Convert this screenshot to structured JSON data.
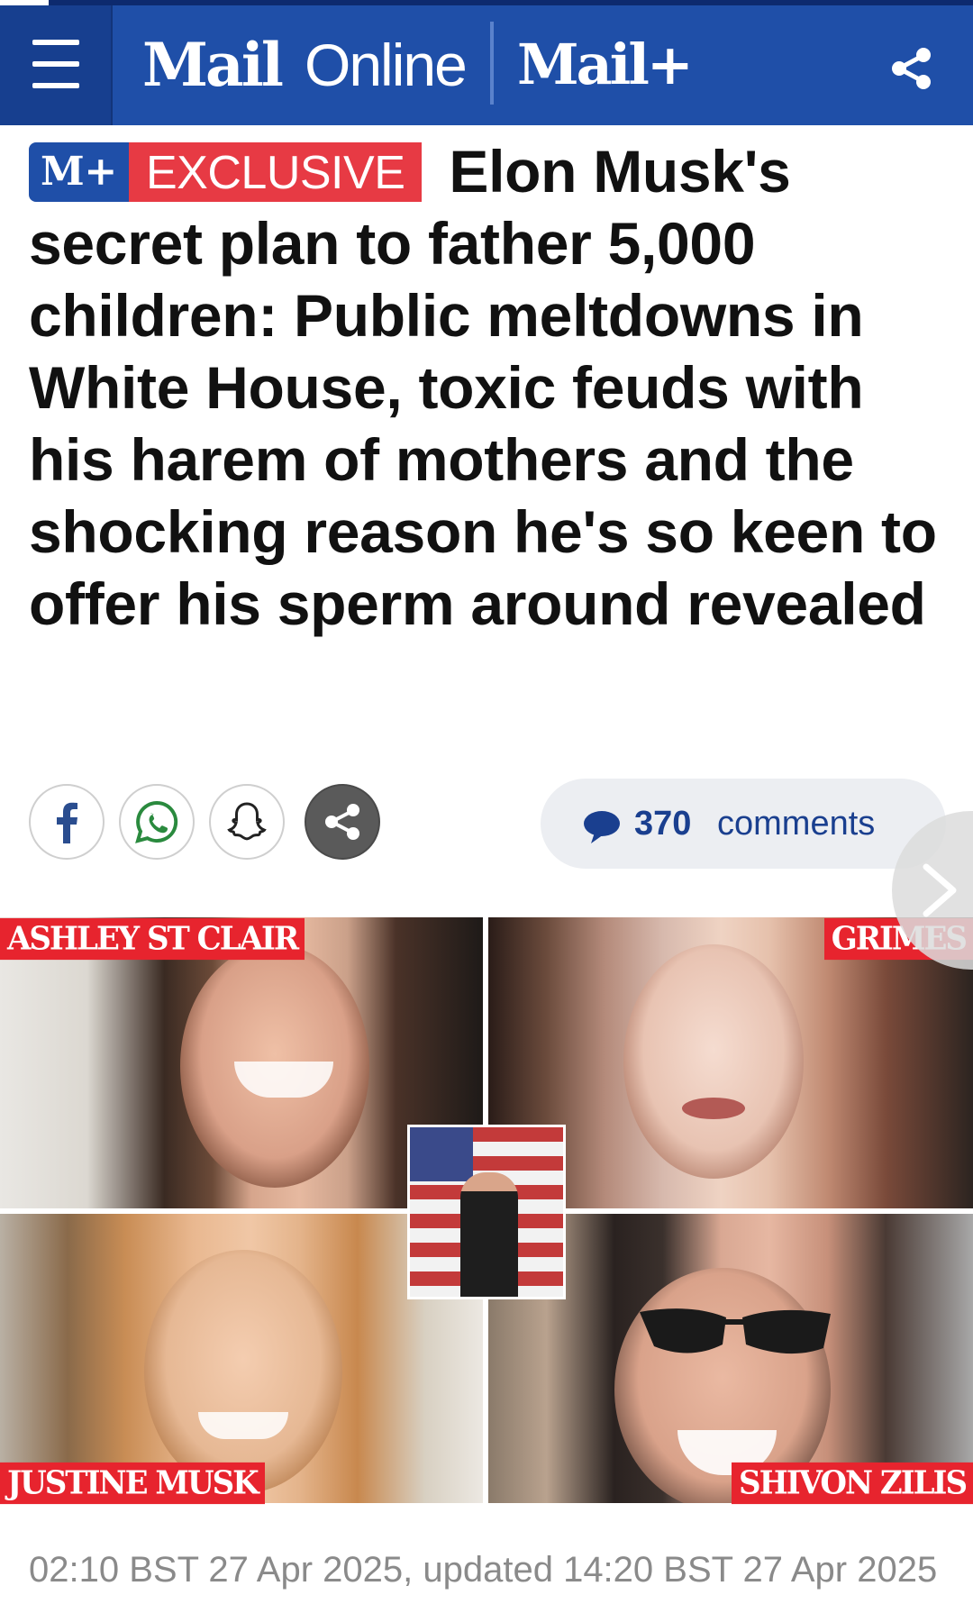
{
  "header": {
    "brand_mail": "Mail",
    "brand_online": "Online",
    "brand_mailplus": "Mail+",
    "icons": [
      "menu-icon",
      "share-icon"
    ],
    "colors": {
      "bar": "#1f4fa8",
      "menu_bg": "#173f8f"
    }
  },
  "article": {
    "badge_mplus": "M+",
    "badge_exclusive": "EXCLUSIVE",
    "headline": "Elon Musk's secret plan to father 5,000 children: Public meltdowns in White House, toxic feuds with his harem of mothers and the shocking reason he's so keen to offer his sperm around revealed",
    "share_buttons": [
      "facebook-icon",
      "whatsapp-icon",
      "snapchat-icon",
      "share-icon"
    ],
    "comments_count": "370",
    "comments_label": "comments",
    "image_labels": {
      "top_left": "ASHLEY ST CLAIR",
      "top_right": "GRIMES",
      "bottom_left": "JUSTINE MUSK",
      "bottom_right": "SHIVON ZILIS"
    },
    "dateline": "02:10 BST 27 Apr 2025, updated 14:20 BST 27 Apr 2025",
    "colors": {
      "exclusive": "#e73a44",
      "label": "#e7242e",
      "comments_text": "#1a3f8f"
    }
  }
}
